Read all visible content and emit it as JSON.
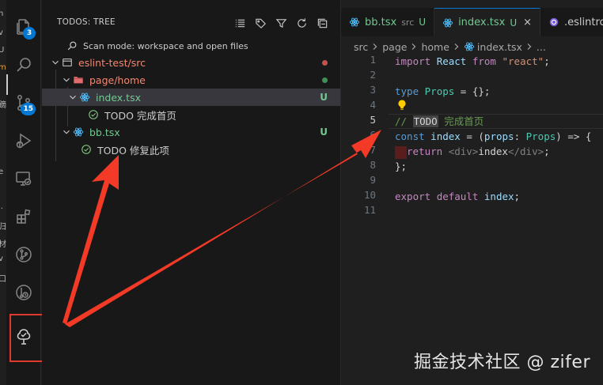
{
  "left_strip_chars": [
    "n",
    "v",
    "U",
    "m",
    "i",
    "蹢",
    "e",
    "l.",
    "归",
    "材",
    "v",
    "口"
  ],
  "activity_bar": {
    "explorer_badge": "3",
    "scm_badge": "15"
  },
  "sidebar": {
    "title": "TODOS: TREE",
    "items": [
      {
        "label": "Scan mode: workspace and open files",
        "color": "#cccccc"
      },
      {
        "label": "eslint-test/src",
        "color": "#f48771"
      },
      {
        "label": "page/home",
        "color": "#f48771"
      },
      {
        "label": "index.tsx",
        "status": "U",
        "color": "#73c991"
      },
      {
        "label": "TODO 完成首页",
        "color": "#cccccc"
      },
      {
        "label": "bb.tsx",
        "status": "U",
        "color": "#73c991"
      },
      {
        "label": "TODO 修复此项",
        "color": "#cccccc"
      }
    ]
  },
  "editor": {
    "tabs": [
      {
        "label": "bb.tsx",
        "sub": "src",
        "status": "U"
      },
      {
        "label": "index.tsx",
        "status": "U",
        "close": "×"
      },
      {
        "label": ".eslintrc"
      }
    ],
    "breadcrumbs": [
      "src",
      "page",
      "home",
      "index.tsx",
      "..."
    ],
    "line_numbers": [
      "1",
      "2",
      "3",
      "4",
      "5",
      "6",
      "7",
      "8",
      "9",
      "10",
      "11"
    ],
    "current_line": "5",
    "code": {
      "l1_import": "import",
      "l1_react": "React",
      "l1_from": "from",
      "l1_str": "\"react\"",
      "l1_semi": ";",
      "l3_type": "type",
      "l3_props": "Props",
      "l3_rest": " = {};",
      "l5_slashes": "// ",
      "l5_todo": "TODO",
      "l5_text": " 完成首页",
      "l6_const": "const",
      "l6_index": "index",
      "l6_eq": " = (",
      "l6_props": "props",
      "l6_colon": ": ",
      "l6_type": "Props",
      "l6_arrow": ") => {",
      "l7_return": "return",
      "l7_open": "<div>",
      "l7_text": "index",
      "l7_close": "</div>",
      "l7_semi": ";",
      "l8": "};",
      "l10_export": "export",
      "l10_default": "default",
      "l10_index": "index",
      "l10_semi": ";"
    }
  },
  "watermark": "掘金技术社区 @ zifer",
  "colors": {
    "accent": "#0078d4",
    "highlight_red": "#e0392d",
    "untracked_green": "#73c991",
    "folder_red": "#f48771",
    "react_blue": "#4fc1ff"
  }
}
